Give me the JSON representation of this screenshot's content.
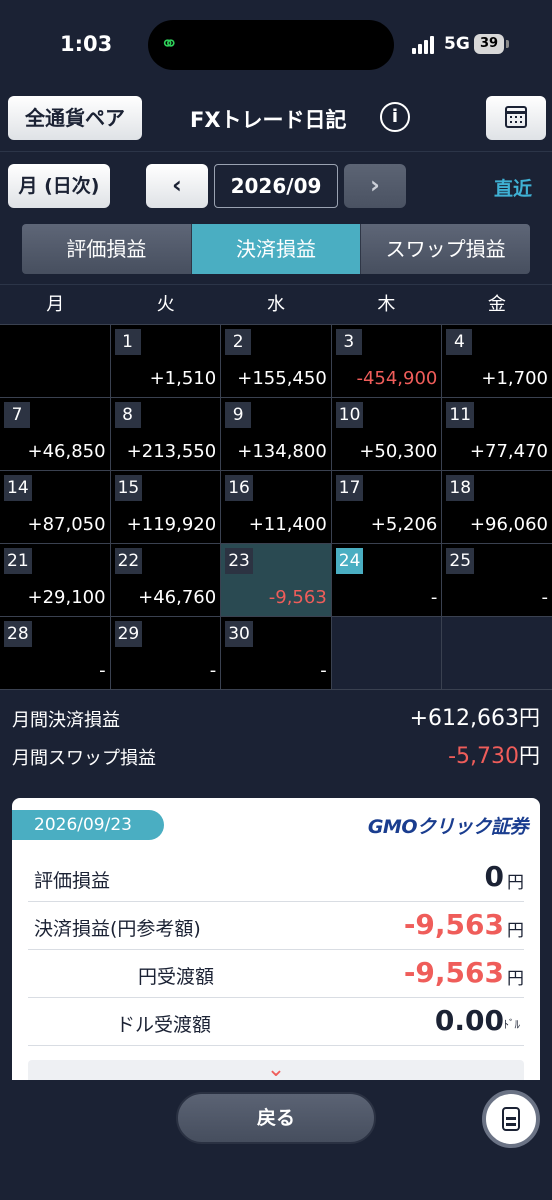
{
  "status_bar": {
    "time": "1:03",
    "network": "5G",
    "battery": "39"
  },
  "header": {
    "pair_button": "全通貨ペア",
    "title": "FXトレード日記",
    "info_icon": "i"
  },
  "nav": {
    "mode_button": "月 (日次)",
    "prev": "‹",
    "month": "2026/09",
    "next": "›",
    "recent": "直近"
  },
  "tabs": [
    {
      "label": "評価損益",
      "active": false
    },
    {
      "label": "決済損益",
      "active": true
    },
    {
      "label": "スワップ損益",
      "active": false
    }
  ],
  "weekdays": [
    "月",
    "火",
    "水",
    "木",
    "金"
  ],
  "calendar": [
    {
      "day": "",
      "amount": ""
    },
    {
      "day": "1",
      "amount": "+1,510"
    },
    {
      "day": "2",
      "amount": "+155,450"
    },
    {
      "day": "3",
      "amount": "-454,900"
    },
    {
      "day": "4",
      "amount": "+1,700"
    },
    {
      "day": "7",
      "amount": "+46,850"
    },
    {
      "day": "8",
      "amount": "+213,550"
    },
    {
      "day": "9",
      "amount": "+134,800"
    },
    {
      "day": "10",
      "amount": "+50,300"
    },
    {
      "day": "11",
      "amount": "+77,470"
    },
    {
      "day": "14",
      "amount": "+87,050"
    },
    {
      "day": "15",
      "amount": "+119,920"
    },
    {
      "day": "16",
      "amount": "+11,400"
    },
    {
      "day": "17",
      "amount": "+5,206"
    },
    {
      "day": "18",
      "amount": "+96,060"
    },
    {
      "day": "21",
      "amount": "+29,100"
    },
    {
      "day": "22",
      "amount": "+46,760"
    },
    {
      "day": "23",
      "amount": "-9,563",
      "selected": true
    },
    {
      "day": "24",
      "amount": "-",
      "today": true
    },
    {
      "day": "25",
      "amount": "-"
    },
    {
      "day": "28",
      "amount": "-"
    },
    {
      "day": "29",
      "amount": "-"
    },
    {
      "day": "30",
      "amount": "-"
    },
    {
      "day": "",
      "amount": "",
      "gray": true
    },
    {
      "day": "",
      "amount": "",
      "gray": true
    }
  ],
  "totals": {
    "settled_label": "月間決済損益",
    "settled_value": "+612,663",
    "swap_label": "月間スワップ損益",
    "swap_value": "-5,730",
    "yen": "円"
  },
  "detail": {
    "date": "2026/09/23",
    "logo_gmo": "GMO",
    "logo_rest": "クリック証券",
    "rows": [
      {
        "label": "評価損益",
        "value": "0",
        "unit": "円"
      },
      {
        "label": "決済損益(円参考額)",
        "value": "-9,563",
        "unit": "円"
      },
      {
        "label": "円受渡額",
        "value": "-9,563",
        "unit": "円"
      },
      {
        "label": "ドル受渡額",
        "value": "0.00",
        "unit": "ﾄﾞﾙ"
      }
    ],
    "expand_icon": "⌄"
  },
  "bottom": {
    "back_button": "戻る"
  },
  "colors": {
    "accent": "#4aaec2",
    "negative": "#ef5d5a",
    "background": "#1b2234"
  }
}
